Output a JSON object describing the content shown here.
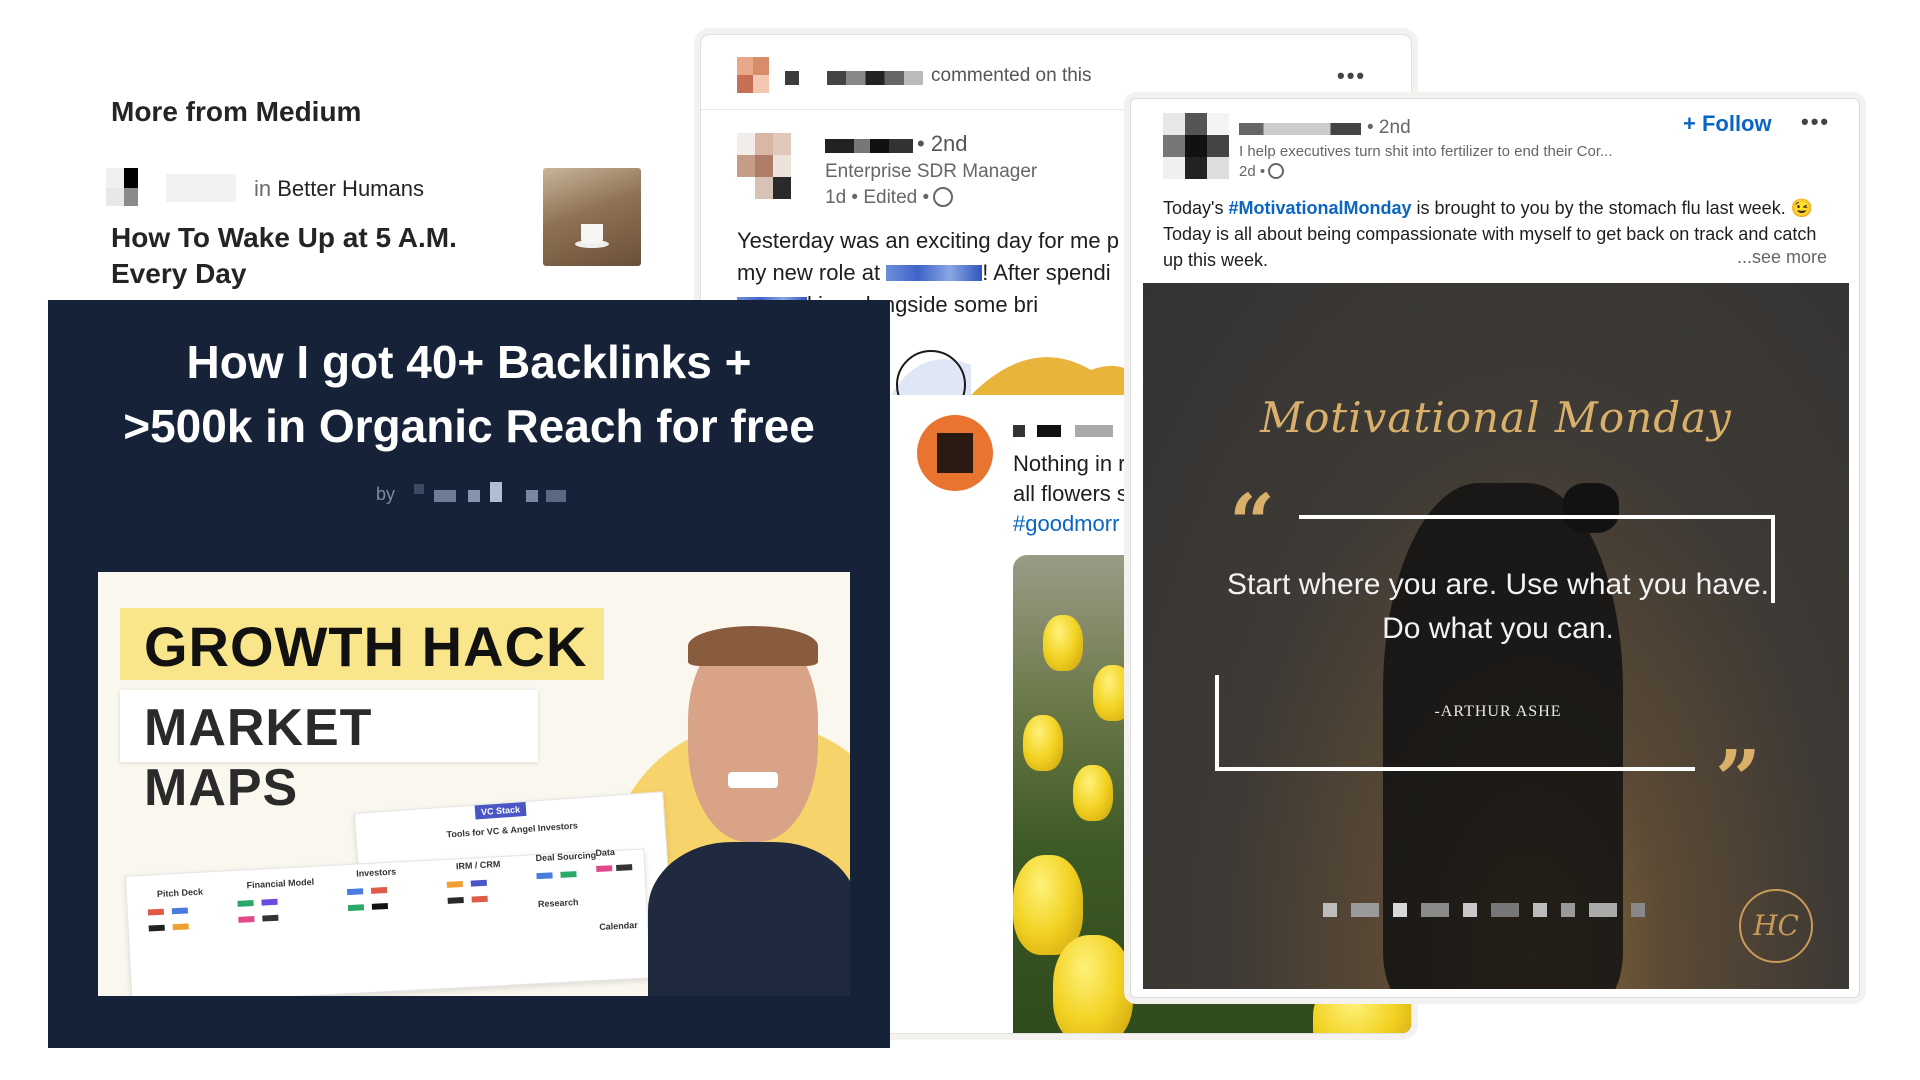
{
  "medium": {
    "heading": "More from Medium",
    "in_label": "in",
    "publication": "Better Humans",
    "article_title": "How To Wake Up at 5 A.M. Every Day"
  },
  "linkedin_middle": {
    "activity_text": "commented on this",
    "degree": "• 2nd",
    "headline": "Enterprise SDR Manager",
    "meta": "1d • Edited •",
    "body_part1": "Yesterday was an exciting day for me p",
    "body_part2": "my new role at",
    "body_part3": "! After spendi",
    "body_part4": "king alongside some bri",
    "shared_text_line1": "Nothing in r",
    "shared_text_line2": "all flowers s",
    "shared_hashtag": "#goodmorr"
  },
  "linkedin_right": {
    "degree": "• 2nd",
    "headline": "I help executives turn shit into fertilizer to end their Cor...",
    "meta": "2d •",
    "follow_label": "+ Follow",
    "body_before_tag": "Today's ",
    "hashtag": "#MotivationalMonday",
    "body_after_tag": " is brought to you by the stomach flu last week. 😉 Today is all about being compassionate with myself to get back on track and catch up this week.",
    "see_more": "...see more",
    "image": {
      "script_title": "Motivational Monday",
      "quote": "Start where you are. Use what you have. Do what you can.",
      "author": "-ARTHUR ASHE",
      "logo": "HC"
    }
  },
  "blog_card": {
    "title_line1": "How I got 40+ Backlinks +",
    "title_line2": ">500k in Organic Reach for free",
    "by_label": "by",
    "thumb_headline1": "GROWTH HACK",
    "thumb_headline2": "MARKET MAPS",
    "thumb_badge": "VC Stack",
    "thumb_sheet_title": "Tools for VC & Angel Investors",
    "thumb_col_labels": [
      "Pitch Deck",
      "Financial Model",
      "Investors",
      "IRM / CRM",
      "Deal Sourcing",
      "Data",
      "Research",
      "Calendar"
    ]
  },
  "colors": {
    "linkedin_blue": "#0a66c2",
    "navy": "#162238",
    "highlight_yellow": "#f9e58a",
    "gold": "#d8b06a"
  }
}
